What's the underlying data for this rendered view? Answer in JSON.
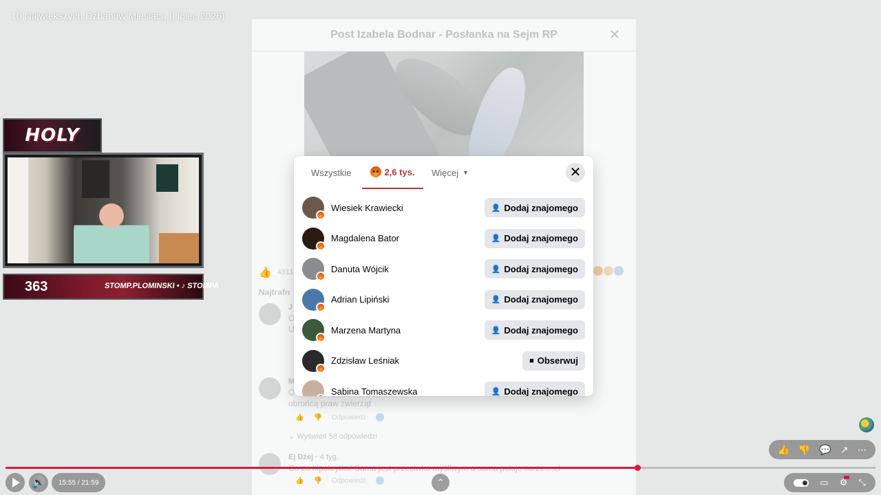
{
  "video": {
    "title": "10 Największych Dzbanów Miesiąca (Lipiec 2026)"
  },
  "post_modal": {
    "title": "Post Izabela Bodnar - Posłanka na Sejm RP",
    "like_count": "4311",
    "sort_label": "Najtrafn",
    "comments": [
      {
        "name": "J",
        "age": "",
        "text_lines": [
          "O",
          "U"
        ]
      },
      {
        "name": "M",
        "age": "",
        "text_lines": [
          "O",
          "obrońcą praw zwierząt"
        ],
        "reply_label": "Odpowiedz"
      },
      {
        "name": "Ej Dżej",
        "age": "4 tyg.",
        "text_lines": [
          "Co za hipokrytka! Sama jest przeciwko myśliwym a sama poluje na ze....el"
        ],
        "reply_label": "Odpowiedz"
      }
    ],
    "view_replies": "Wyświetl 58 odpowiedzi"
  },
  "reactions_dialog": {
    "tab_all": "Wszystkie",
    "tab_angry_count": "2,6 tys.",
    "tab_more": "Więcej",
    "people": [
      {
        "name": "Wiesiek Krawiecki",
        "action": "Dodaj znajomego",
        "action_icon": "add-friend-icon",
        "avatar_color": "#6b5a4a"
      },
      {
        "name": "Magdalena Bator",
        "action": "Dodaj znajomego",
        "action_icon": "add-friend-icon",
        "avatar_color": "#2a1a12"
      },
      {
        "name": "Danuta Wójcik",
        "action": "Dodaj znajomego",
        "action_icon": "add-friend-icon",
        "avatar_color": "#8a8c90"
      },
      {
        "name": "Adrian Lipiński",
        "action": "Dodaj znajomego",
        "action_icon": "add-friend-icon",
        "avatar_color": "#4a7aa8"
      },
      {
        "name": "Marzena Martyna",
        "action": "Dodaj znajomego",
        "action_icon": "add-friend-icon",
        "avatar_color": "#3a5a3a"
      },
      {
        "name": "Zdzisław Leśniak",
        "action": "Obserwuj",
        "action_icon": "follow-icon",
        "avatar_color": "#2a2a2a"
      },
      {
        "name": "Sabina Tomaszewska",
        "action": "Dodaj znajomego",
        "action_icon": "add-friend-icon",
        "avatar_color": "#c8b0a0"
      }
    ]
  },
  "overlay": {
    "logo_text": "HOLY",
    "counter": "363",
    "handle": "STOMP.PLOMINSKI • ♪ STOMPA"
  },
  "player": {
    "time": "15:55 / 21:59",
    "progress_fraction": 0.726,
    "accent_color": "#e0163c"
  }
}
